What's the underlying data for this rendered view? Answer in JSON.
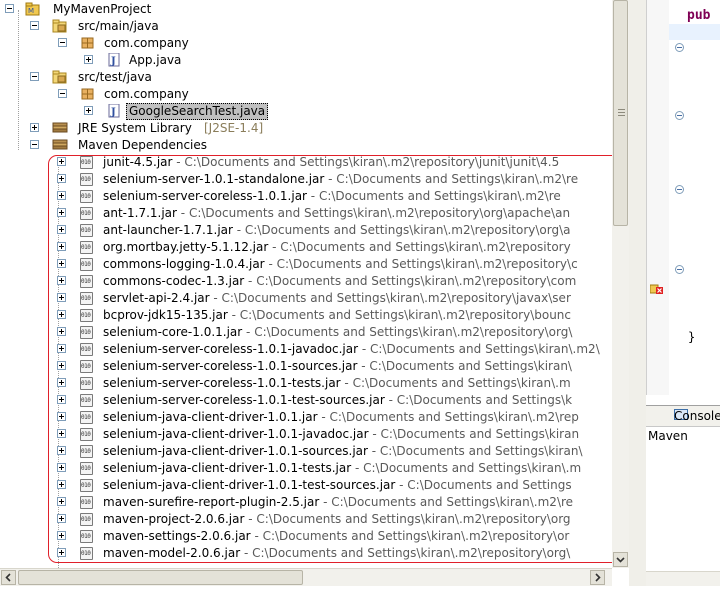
{
  "tree": {
    "project": "MyMavenProject",
    "nodes": [
      {
        "label": "src/main/java",
        "kind": "srcfolder",
        "expanded": true
      },
      {
        "label": "com.company",
        "kind": "package",
        "expanded": true
      },
      {
        "label": "App.java",
        "kind": "java",
        "expanded": false
      },
      {
        "label": "src/test/java",
        "kind": "srcfolder",
        "expanded": true
      },
      {
        "label": "com.company",
        "kind": "package",
        "expanded": true
      },
      {
        "label": "GoogleSearchTest.java",
        "kind": "java",
        "expanded": false,
        "selected": true
      },
      {
        "label": "JRE System Library",
        "suffix": "[J2SE-1.4]",
        "kind": "library",
        "expanded": false
      },
      {
        "label": "Maven Dependencies",
        "kind": "library",
        "expanded": true
      }
    ],
    "jars": [
      {
        "name": "junit-4.5.jar",
        "path": "C:\\Documents and Settings\\kiran\\.m2\\repository\\junit\\junit\\4.5"
      },
      {
        "name": "selenium-server-1.0.1-standalone.jar",
        "path": "C:\\Documents and Settings\\kiran\\.m2\\re"
      },
      {
        "name": "selenium-server-coreless-1.0.1.jar",
        "path": "C:\\Documents and Settings\\kiran\\.m2\\re"
      },
      {
        "name": "ant-1.7.1.jar",
        "path": "C:\\Documents and Settings\\kiran\\.m2\\repository\\org\\apache\\an"
      },
      {
        "name": "ant-launcher-1.7.1.jar",
        "path": "C:\\Documents and Settings\\kiran\\.m2\\repository\\org\\a"
      },
      {
        "name": "org.mortbay.jetty-5.1.12.jar",
        "path": "C:\\Documents and Settings\\kiran\\.m2\\repository"
      },
      {
        "name": "commons-logging-1.0.4.jar",
        "path": "C:\\Documents and Settings\\kiran\\.m2\\repository\\c"
      },
      {
        "name": "commons-codec-1.3.jar",
        "path": "C:\\Documents and Settings\\kiran\\.m2\\repository\\com"
      },
      {
        "name": "servlet-api-2.4.jar",
        "path": "C:\\Documents and Settings\\kiran\\.m2\\repository\\javax\\ser"
      },
      {
        "name": "bcprov-jdk15-135.jar",
        "path": "C:\\Documents and Settings\\kiran\\.m2\\repository\\bounc"
      },
      {
        "name": "selenium-core-1.0.1.jar",
        "path": "C:\\Documents and Settings\\kiran\\.m2\\repository\\org\\"
      },
      {
        "name": "selenium-server-coreless-1.0.1-javadoc.jar",
        "path": "C:\\Documents and Settings\\kiran\\.m2\\"
      },
      {
        "name": "selenium-server-coreless-1.0.1-sources.jar",
        "path": "C:\\Documents and Settings\\kiran\\"
      },
      {
        "name": "selenium-server-coreless-1.0.1-tests.jar",
        "path": "C:\\Documents and Settings\\kiran\\.m"
      },
      {
        "name": "selenium-server-coreless-1.0.1-test-sources.jar",
        "path": "C:\\Documents and Settings\\k"
      },
      {
        "name": "selenium-java-client-driver-1.0.1.jar",
        "path": "C:\\Documents and Settings\\kiran\\.m2\\rep"
      },
      {
        "name": "selenium-java-client-driver-1.0.1-javadoc.jar",
        "path": "C:\\Documents and Settings\\kiran"
      },
      {
        "name": "selenium-java-client-driver-1.0.1-sources.jar",
        "path": "C:\\Documents and Settings\\kiran\\"
      },
      {
        "name": "selenium-java-client-driver-1.0.1-tests.jar",
        "path": "C:\\Documents and Settings\\kiran\\.m"
      },
      {
        "name": "selenium-java-client-driver-1.0.1-test-sources.jar",
        "path": "C:\\Documents and Settings"
      },
      {
        "name": "maven-surefire-report-plugin-2.5.jar",
        "path": "C:\\Documents and Settings\\kiran\\.m2\\re"
      },
      {
        "name": "maven-project-2.0.6.jar",
        "path": "C:\\Documents and Settings\\kiran\\.m2\\repository\\org"
      },
      {
        "name": "maven-settings-2.0.6.jar",
        "path": "C:\\Documents and Settings\\kiran\\.m2\\repository\\or"
      },
      {
        "name": "maven-model-2.0.6.jar",
        "path": "C:\\Documents and Settings\\kiran\\.m2\\repository\\org\\"
      }
    ],
    "separator": " - "
  },
  "editor": {
    "keyword": "pub",
    "brace": "}"
  },
  "console": {
    "tab_label": "Console",
    "subtitle": "Maven Cons"
  },
  "colors": {
    "highlight": "#e0202a",
    "selection": "#c0c0c0",
    "keyword": "#7f0055"
  }
}
